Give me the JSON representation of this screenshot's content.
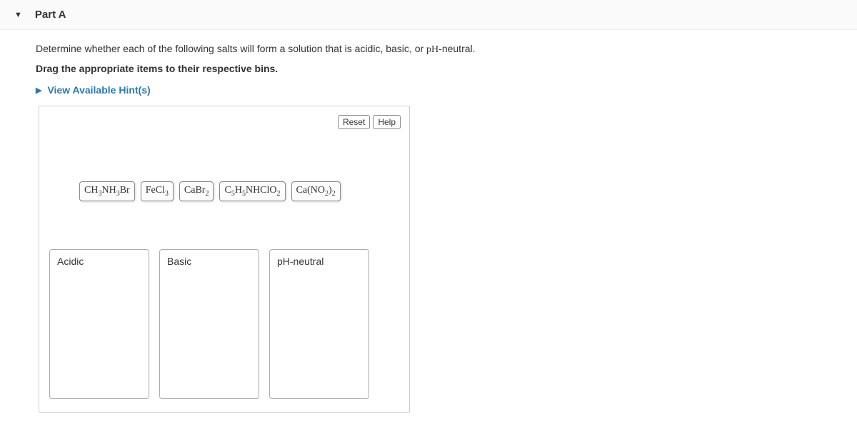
{
  "section": {
    "title": "Part A"
  },
  "question": {
    "prefix": "Determine whether each of the following salts will form a solution that is acidic, basic, or ",
    "phTerm": "pH",
    "suffix": "-neutral.",
    "instruction": "Drag the appropriate items to their respective bins."
  },
  "hints": {
    "label": "View Available Hint(s)"
  },
  "controls": {
    "reset": "Reset",
    "help": "Help"
  },
  "items": [
    {
      "formula_html": "CH<sub>3</sub>NH<sub>3</sub>Br"
    },
    {
      "formula_html": "FeCl<sub>3</sub>"
    },
    {
      "formula_html": "CaBr<sub>2</sub>"
    },
    {
      "formula_html": "C<sub>5</sub>H<sub>5</sub>NHClO<sub>2</sub>"
    },
    {
      "formula_html": "Ca(NO<sub>2</sub>)<sub>2</sub>"
    }
  ],
  "bins": [
    {
      "label": "Acidic"
    },
    {
      "label": "Basic"
    },
    {
      "label": "pH-neutral"
    }
  ]
}
